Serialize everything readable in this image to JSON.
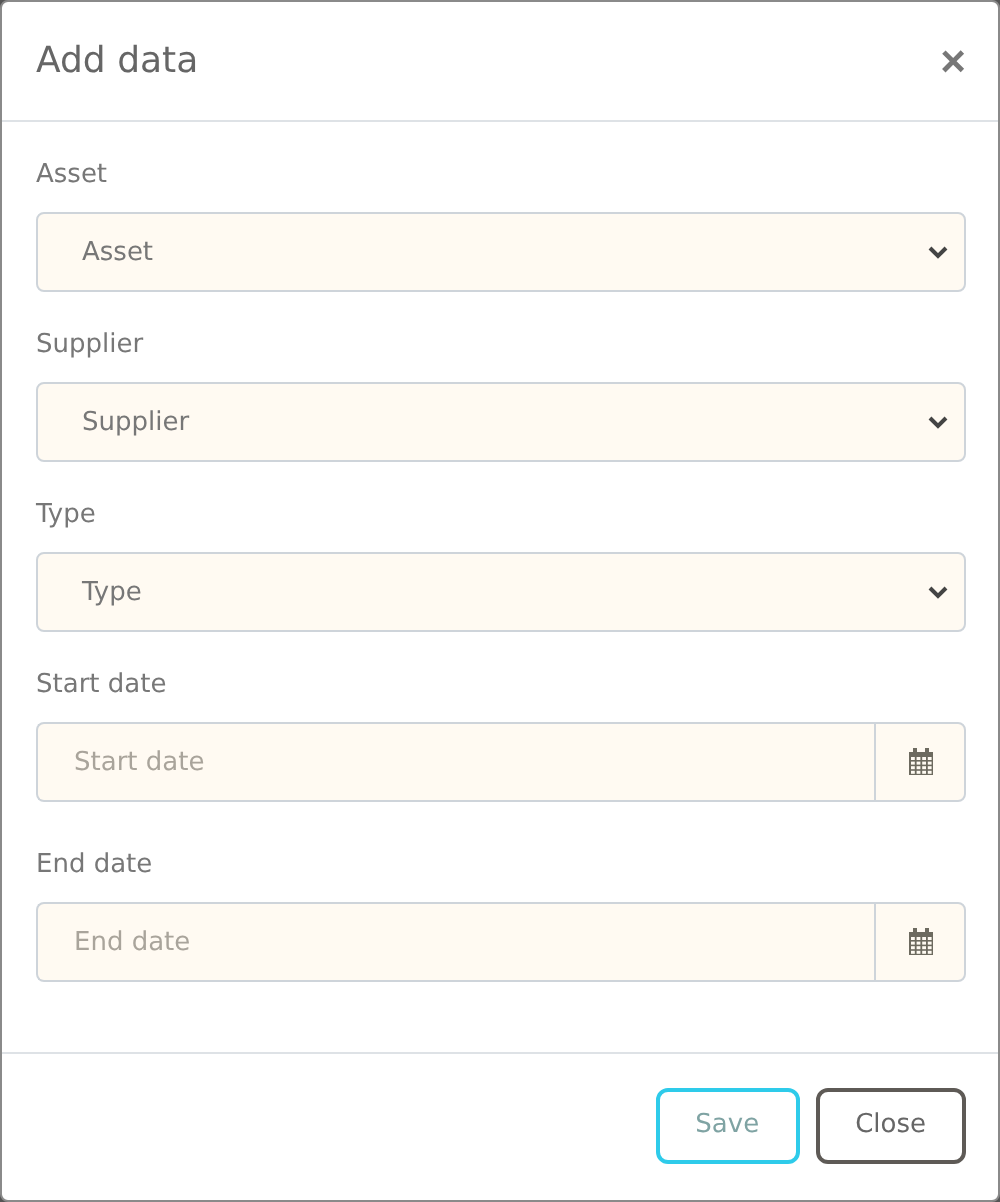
{
  "dialog": {
    "title": "Add data",
    "close_symbol": "×"
  },
  "fields": [
    {
      "kind": "select",
      "label": "Asset",
      "value": "Asset"
    },
    {
      "kind": "select",
      "label": "Supplier",
      "value": "Supplier"
    },
    {
      "kind": "select",
      "label": "Type",
      "value": "Type"
    },
    {
      "kind": "date",
      "label": "Start date",
      "placeholder": "Start date"
    },
    {
      "kind": "date",
      "label": "End date",
      "placeholder": "End date"
    }
  ],
  "buttons": [
    {
      "kind": "primary",
      "label": "Save"
    },
    {
      "kind": "secondary",
      "label": "Close"
    }
  ]
}
